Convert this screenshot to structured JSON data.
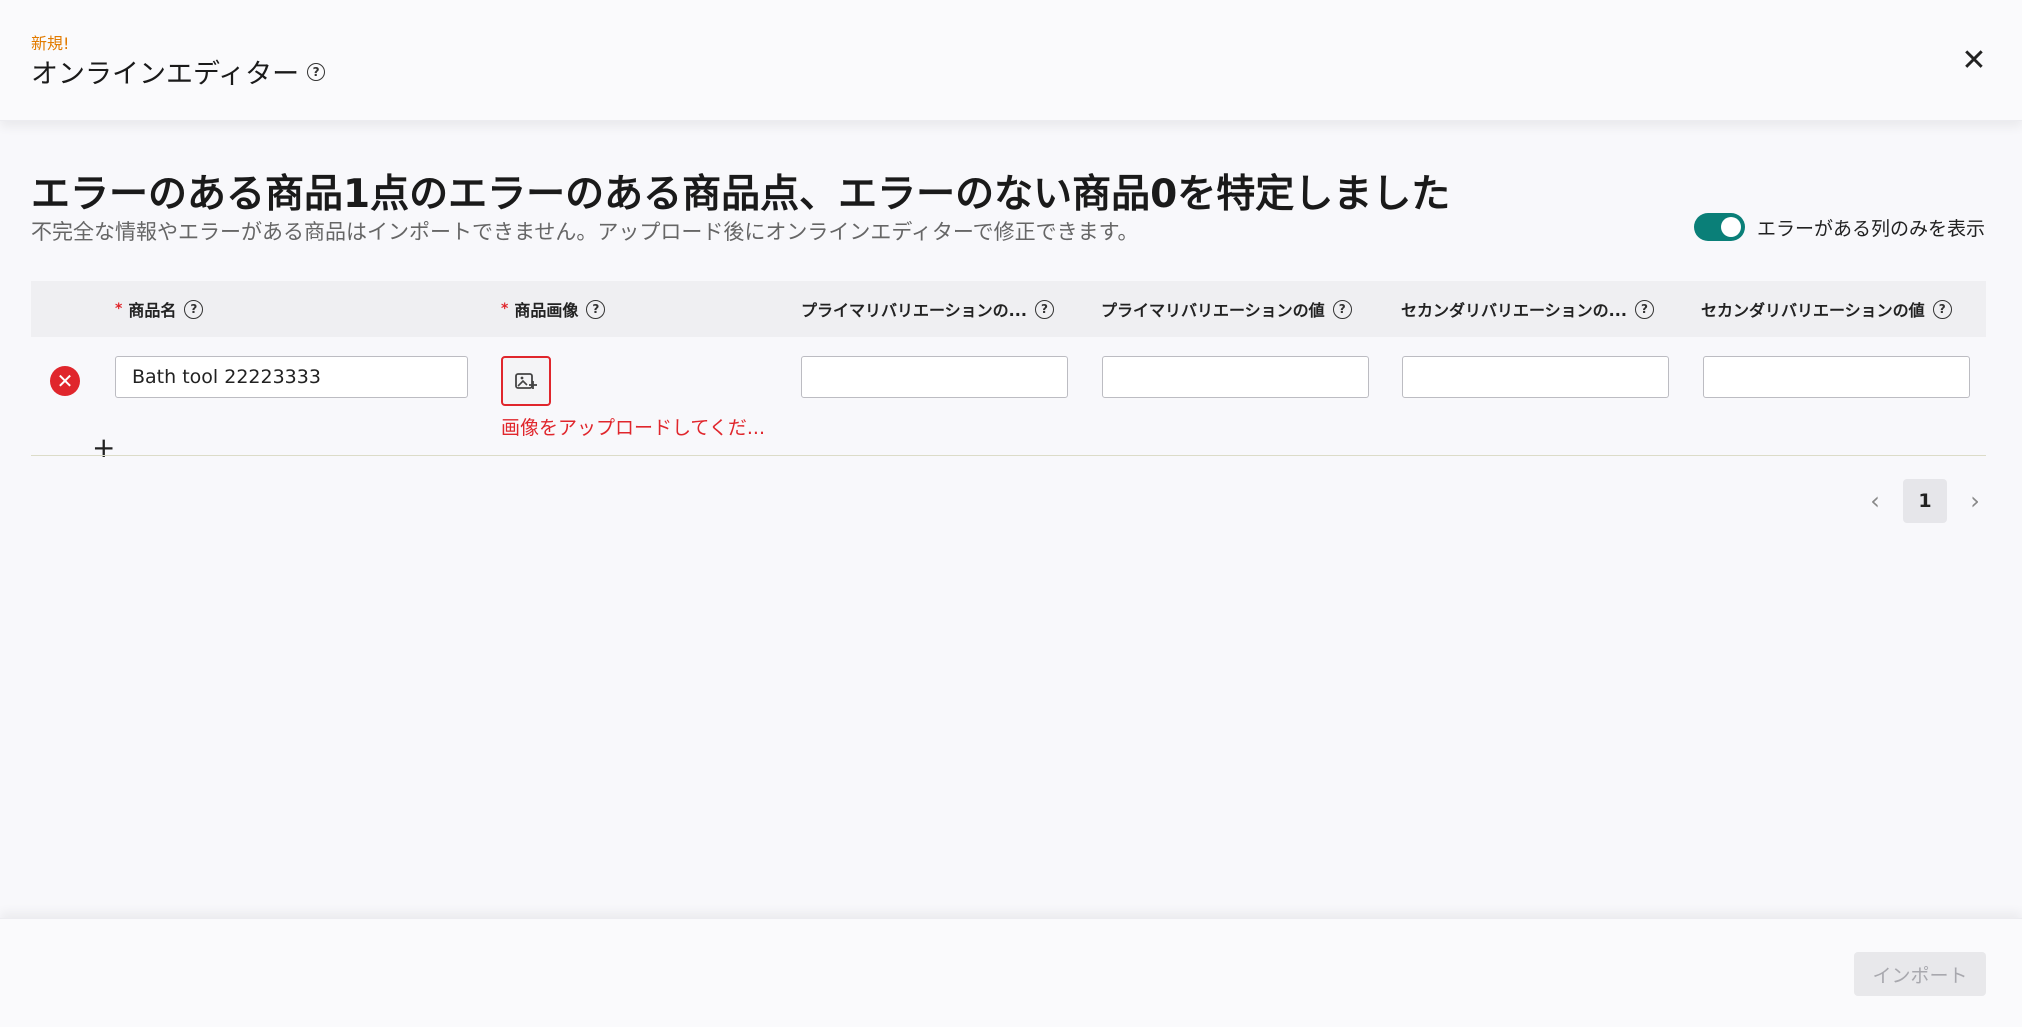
{
  "header": {
    "badge": "新規!",
    "title": "オンラインエディター",
    "help_glyph": "?",
    "close_glyph": "✕"
  },
  "summary": {
    "title": "エラーのある商品1点のエラーのある商品点、エラーのない商品0を特定しました",
    "subtitle": "不完全な情報やエラーがある商品はインポートできません。アップロード後にオンラインエディターで修正できます。"
  },
  "filter_toggle": {
    "label": "エラーがある列のみを表示",
    "checked": true
  },
  "table": {
    "required_mark": "*",
    "columns": [
      {
        "label": "商品名",
        "required": true
      },
      {
        "label": "商品画像",
        "required": true
      },
      {
        "label": "プライマリバリエーションの...",
        "required": false
      },
      {
        "label": "プライマリバリエーションの値",
        "required": false
      },
      {
        "label": "セカンダリバリエーションの...",
        "required": false
      },
      {
        "label": "セカンダリバリエーションの値",
        "required": false
      }
    ],
    "rows": [
      {
        "status_glyph": "✕",
        "product_name": "Bath tool 22223333",
        "image_error": "画像をアップロードしてくだ...",
        "primary_variation_name": "",
        "primary_variation_value": "",
        "secondary_variation_name": "",
        "secondary_variation_value": ""
      }
    ],
    "cursor_glyph": "+"
  },
  "pagination": {
    "prev_glyph": "‹",
    "current_page": "1",
    "next_glyph": "›"
  },
  "footer": {
    "import_label": "インポート"
  },
  "colors": {
    "accent_toggle": "#0a7f78",
    "error": "#e0262c",
    "badge_new": "#e27b00"
  }
}
